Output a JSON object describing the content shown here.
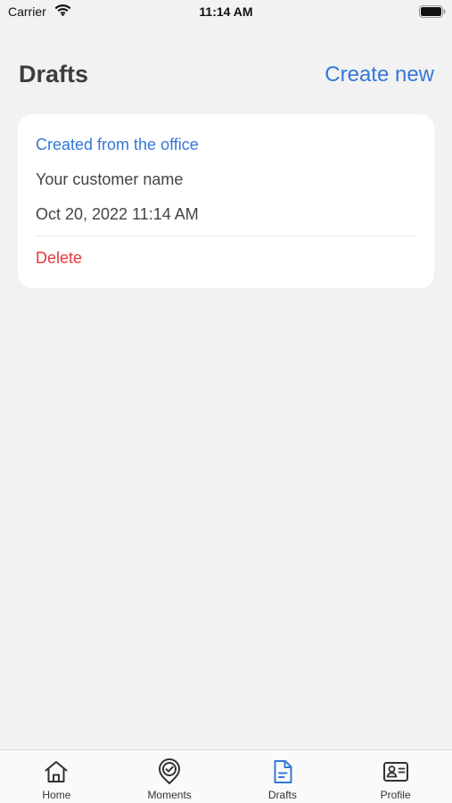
{
  "status_bar": {
    "carrier": "Carrier",
    "time": "11:14 AM"
  },
  "header": {
    "title": "Drafts",
    "create_label": "Create new"
  },
  "drafts": [
    {
      "title": "Created from the office",
      "customer": "Your customer name",
      "date": "Oct 20, 2022 11:14 AM",
      "delete_label": "Delete"
    }
  ],
  "tabs": [
    {
      "label": "Home",
      "icon": "home-icon"
    },
    {
      "label": "Moments",
      "icon": "location-check-icon"
    },
    {
      "label": "Drafts",
      "icon": "document-icon",
      "active": true
    },
    {
      "label": "Profile",
      "icon": "id-card-icon"
    }
  ],
  "colors": {
    "accent": "#3478d8",
    "danger": "#e4373d",
    "background": "#f2f2f2"
  }
}
